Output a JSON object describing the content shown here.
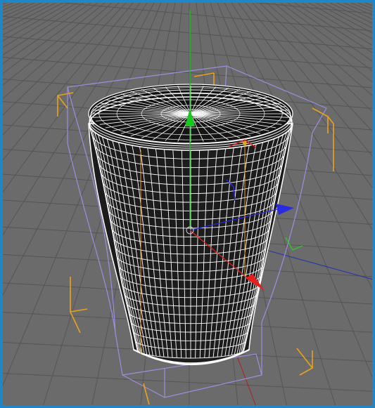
{
  "viewport": {
    "frame_color": "#1f86c8",
    "background_color": "#6b6b6b",
    "grid_color": "#555555",
    "mesh_fill_color": "#1c1c1c",
    "wire_color": "#ffffff",
    "bbox_color": "#9b8fe0",
    "corner_marker_color": "#e8a21d"
  },
  "object": {
    "type": "tapered cup mesh",
    "selected": true
  },
  "gizmo": {
    "y_axis_color": "#19c81e",
    "x_axis_color": "#e81e1e",
    "z_axis_color": "#2a2ae0",
    "plane_handle_color": "#2ec82e"
  }
}
